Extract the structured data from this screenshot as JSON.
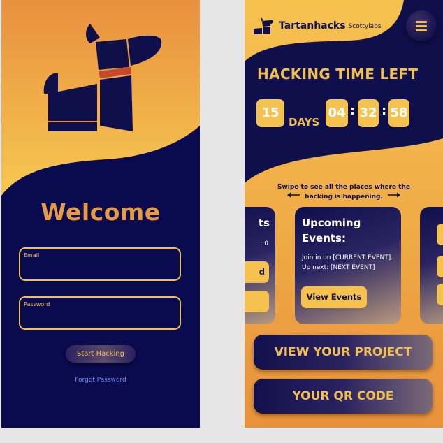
{
  "login": {
    "welcome": "Welcome",
    "email": {
      "label": "Email",
      "value": ""
    },
    "password": {
      "label": "Password",
      "value": ""
    },
    "start_button": "Start Hacking",
    "forgot_link": "Forgot Password"
  },
  "dashboard": {
    "brand": {
      "name": "Tartanhacks",
      "sub": "Scottylabs"
    },
    "menu_icon": "hamburger-menu-icon",
    "countdown": {
      "title": "HACKING TIME LEFT",
      "days": "15",
      "days_label": "DAYS",
      "hours": "04",
      "minutes": "32",
      "seconds": "58"
    },
    "swipe_hint": "Swipe to see all the places where the hacking is happening.",
    "cards": {
      "left": {
        "title_fragment": "ts",
        "count_fragment": ": 0",
        "button_fragment": "d"
      },
      "main": {
        "title": "Upcoming Events:",
        "text": "Join in on [CURRENT EVENT]. Up next: [NEXT EVENT]",
        "button": "View Events"
      }
    },
    "buttons": {
      "project": "VIEW YOUR PROJECT",
      "qr": "YOUR QR CODE"
    }
  },
  "colors": {
    "navy": "#0a0a4e",
    "gold": "#f2bf4f",
    "orange": "#e79a45",
    "link_blue": "#6f8cf0"
  }
}
